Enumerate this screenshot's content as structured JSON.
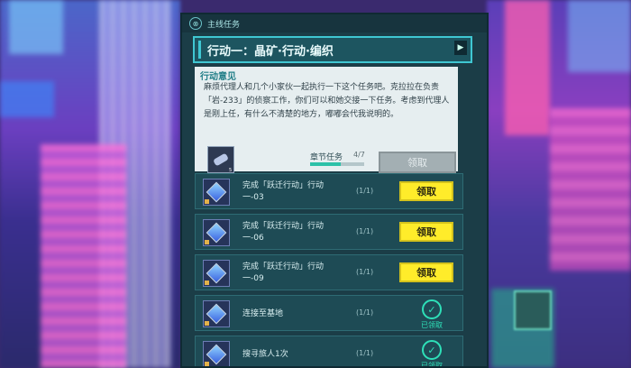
{
  "panel": {
    "close_icon_glyph": "⊗",
    "tag": "主线任务",
    "chapter_title": "行动一：晶矿·行动·编织",
    "chapter_arrow_glyph": "▶"
  },
  "description": {
    "title": "行动意见",
    "text": "麻烦代理人和几个小家伙一起执行一下这个任务吧。克拉拉在负责「岩-233」的侦察工作，你们可以和她交接一下任务。考虑到代理人是刚上任，有什么不清楚的地方，嘟嘟会代我说明的。",
    "reward_count": "5",
    "progress_label": "章节任务",
    "progress_count": "4/7",
    "progress_fraction": 0.57,
    "claim_label": "领取"
  },
  "tasks": [
    {
      "name": "完成「跃迁行动」行动一-03",
      "progress": "(1/1)",
      "status": "claimable",
      "action_label": "领取"
    },
    {
      "name": "完成「跃迁行动」行动一-06",
      "progress": "(1/1)",
      "status": "claimable",
      "action_label": "领取"
    },
    {
      "name": "完成「跃迁行动」行动一-09",
      "progress": "(1/1)",
      "status": "claimable",
      "action_label": "领取"
    },
    {
      "name": "连接至基地",
      "progress": "(1/1)",
      "status": "claimed",
      "action_label": "已领取"
    },
    {
      "name": "搜寻旅人1次",
      "progress": "(1/1)",
      "status": "claimed",
      "action_label": "已领取"
    }
  ],
  "colors": {
    "accent": "#3fc7d2",
    "claim_yellow": "#ffec2a",
    "claimed_green": "#2ee0b8",
    "panel_bg": "#1b3d47"
  }
}
